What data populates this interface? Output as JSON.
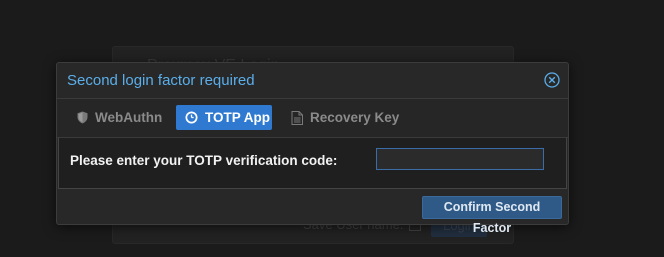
{
  "background_dialog": {
    "title": "Proxmox VE Login",
    "save_user_name_label": "Save User name:",
    "login_button_label": "Login"
  },
  "modal": {
    "title": "Second login factor required",
    "close_icon": "close-circle-icon",
    "tabs": [
      {
        "label": "WebAuthn",
        "icon": "shield-icon",
        "active": false
      },
      {
        "label": "TOTP App",
        "icon": "clock-icon",
        "active": true
      },
      {
        "label": "Recovery Key",
        "icon": "document-icon",
        "active": false
      }
    ],
    "totp": {
      "prompt": "Please enter your TOTP verification code:",
      "value": ""
    },
    "confirm_button_label": "Confirm Second Factor"
  },
  "colors": {
    "accent": "#2f7ad0",
    "title": "#5aaeea",
    "confirm_button": "#2f5a87",
    "background": "#1f1f1f"
  }
}
